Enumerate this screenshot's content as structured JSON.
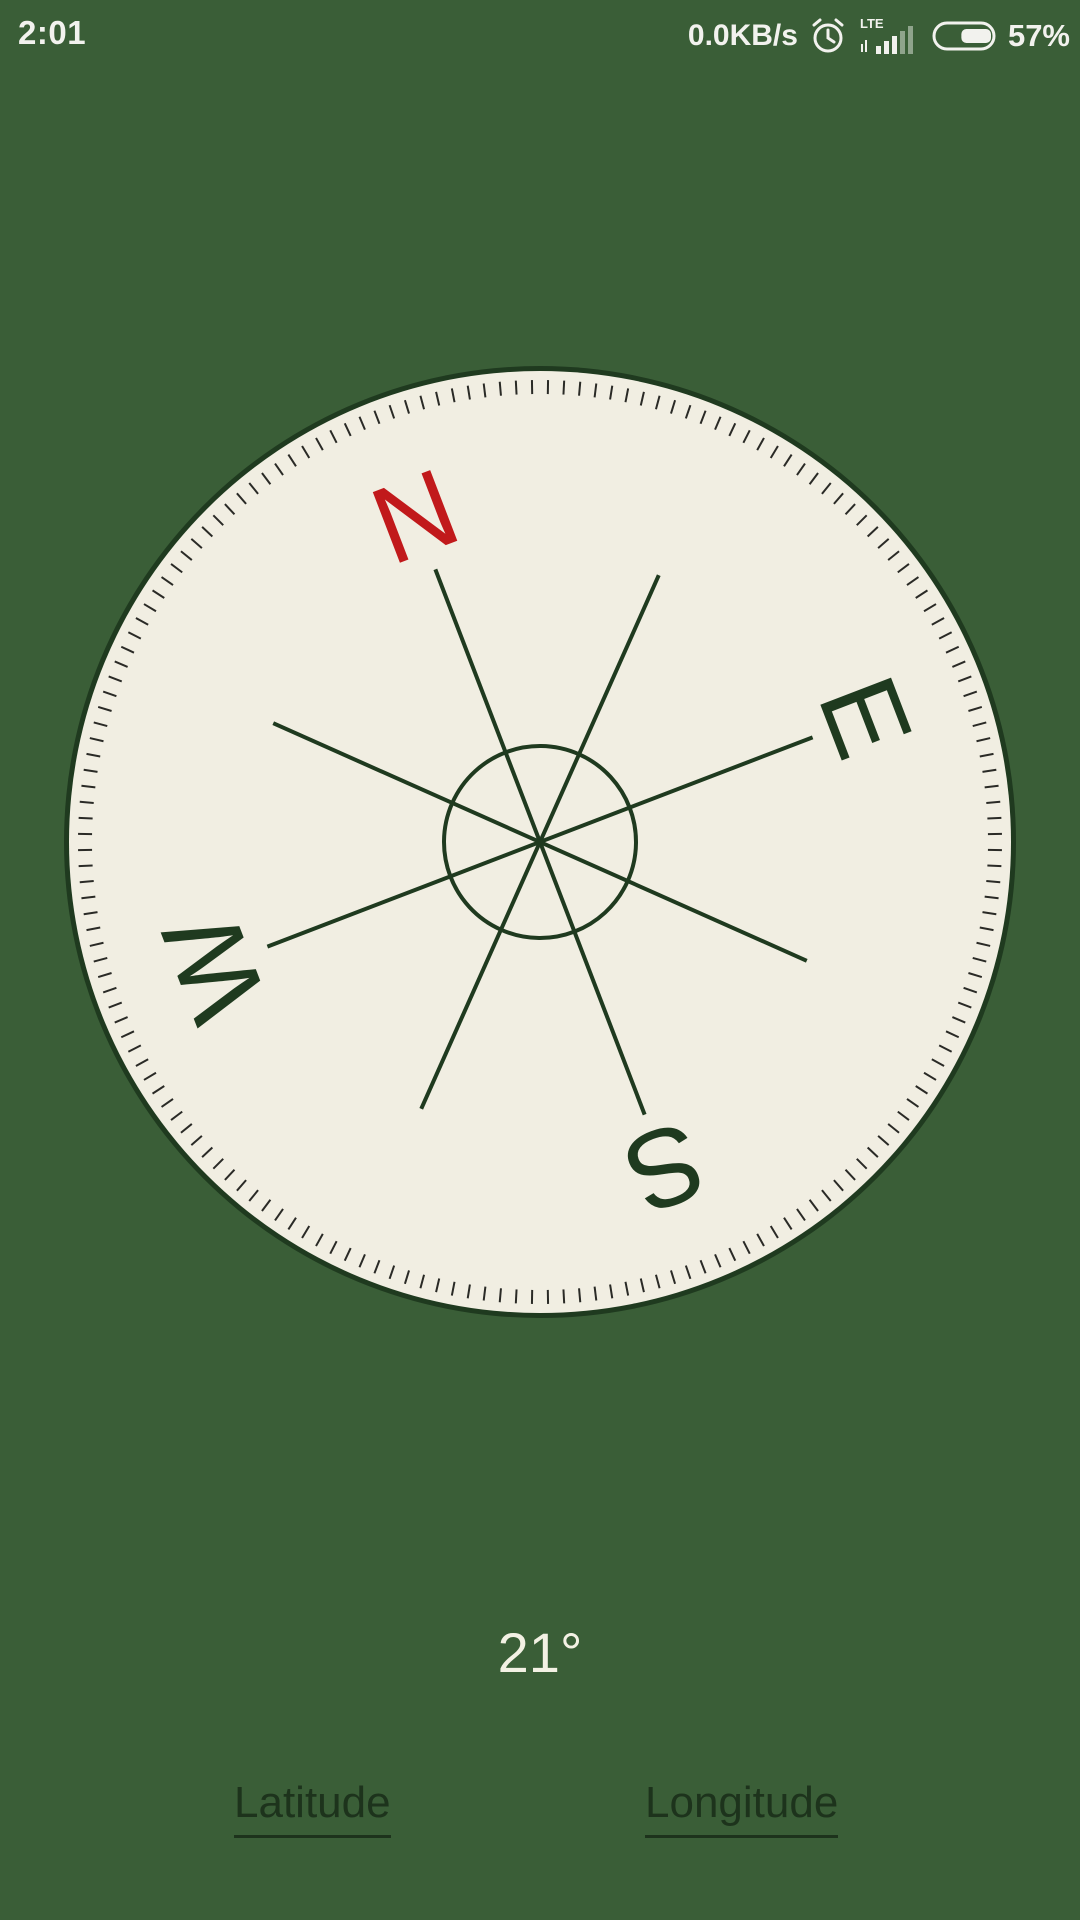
{
  "status_bar": {
    "time": "2:01",
    "net_speed": "0.0KB/s",
    "network_type": "LTE",
    "battery_percent": "57%",
    "battery_level": 0.57,
    "icons": [
      "alarm-clock-icon",
      "signal-strength-icon",
      "battery-icon"
    ]
  },
  "compass": {
    "cardinals": {
      "north": "N",
      "east": "E",
      "south": "S",
      "west": "W"
    },
    "rotation_degrees": 21,
    "colors": {
      "face": "#f1eee2",
      "rim": "#1f3a1f",
      "north": "#c1191b",
      "accent_ticks": "#c1191b",
      "lines": "#1f3a1f"
    }
  },
  "heading": {
    "value": "21°"
  },
  "coordinates": {
    "latitude_label": "Latitude",
    "longitude_label": "Longitude"
  },
  "theme": {
    "background": "#3a5e37"
  }
}
